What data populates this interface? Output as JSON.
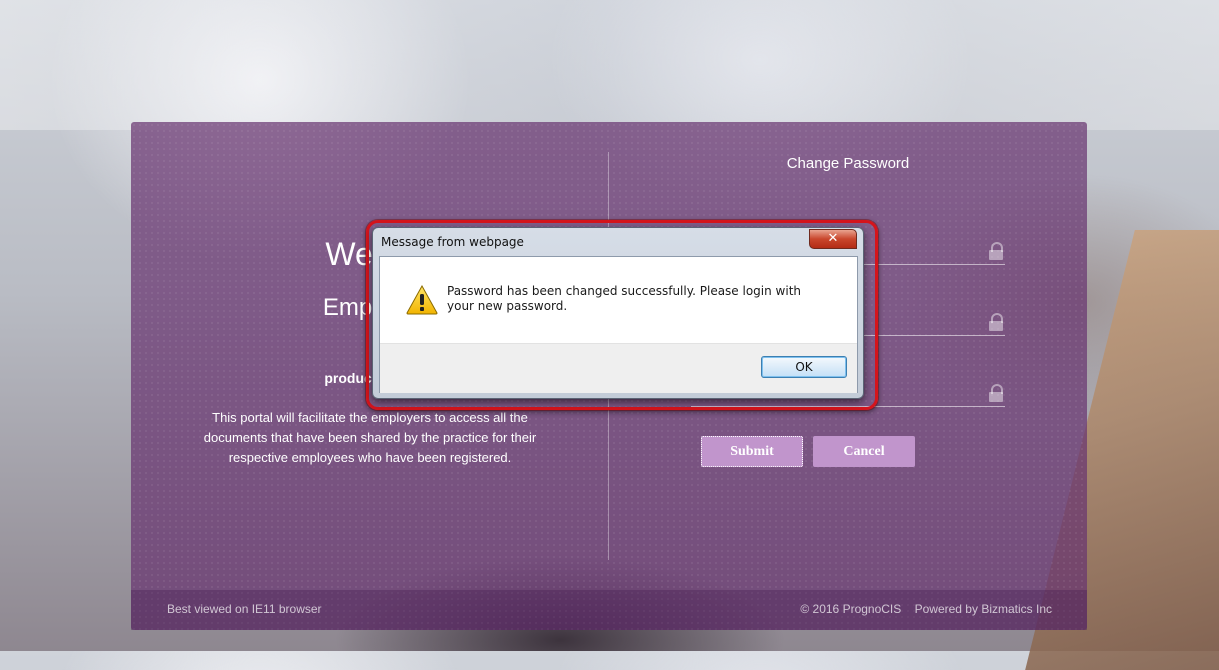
{
  "left": {
    "welcome": "Welco",
    "employer": "Employe",
    "product": "product by Bi",
    "description": "This portal will facilitate the employers to access all the documents that have been shared by the practice for their respective employees who have been registered."
  },
  "right": {
    "title": "Change Password",
    "fields": [
      {
        "name": "current-password",
        "value": ""
      },
      {
        "name": "new-password",
        "value": ""
      },
      {
        "name": "confirm-password",
        "value": ""
      }
    ],
    "submit_label": "Submit",
    "cancel_label": "Cancel"
  },
  "footer": {
    "left": "Best viewed on IE11 browser",
    "copyright": "© 2016 PrognoCIS",
    "powered": "Powered by Bizmatics Inc"
  },
  "dialog": {
    "title": "Message from webpage",
    "close_glyph": "✕",
    "icon": "warning-icon",
    "message": "Password has been changed successfully. Please login with your new password.",
    "ok_label": "OK"
  },
  "colors": {
    "panel": "#683470",
    "button": "#c195cc",
    "highlight_ring": "#d5141c"
  }
}
